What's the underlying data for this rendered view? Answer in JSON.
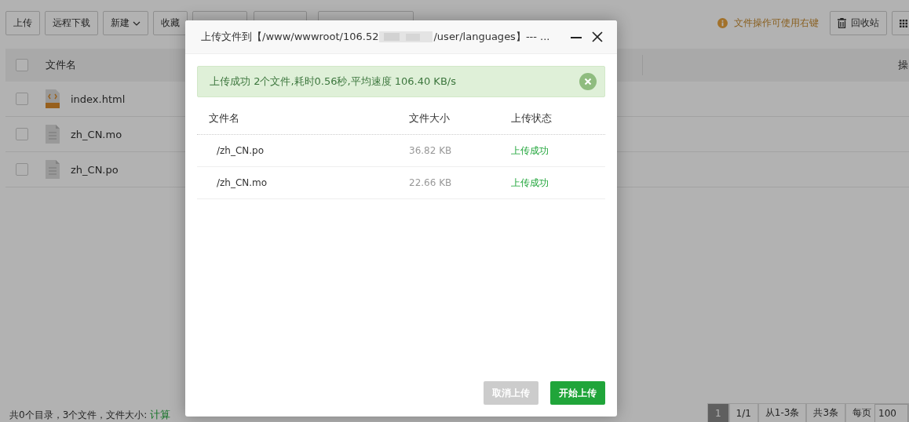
{
  "toolbar": {
    "buttons": [
      {
        "label": "上传",
        "dropdown": false
      },
      {
        "label": "远程下载",
        "dropdown": false
      },
      {
        "label": "新建",
        "dropdown": true
      },
      {
        "label": "收藏",
        "dropdown": false
      }
    ],
    "hint": "文件操作可使用右键",
    "recycle_button": "回收站"
  },
  "file_table": {
    "columns": [
      "文件名",
      "操"
    ],
    "all_checked": false,
    "rows": [
      {
        "name": "index.html",
        "kind": "html",
        "checked": false
      },
      {
        "name": "zh_CN.mo",
        "kind": "file",
        "checked": false
      },
      {
        "name": "zh_CN.po",
        "kind": "file",
        "checked": false
      }
    ]
  },
  "status_bar": {
    "summary": "共0个目录，3个文件，文件大小:",
    "link": "计算"
  },
  "pagination": {
    "pages": [
      {
        "label": "1",
        "selected": true
      }
    ],
    "total_pages": "1/1",
    "range": "从1-3条",
    "total": "共3条",
    "per_page_label": "每页",
    "per_page": "100"
  },
  "dialog": {
    "title_start": "上传文件到【/www/wwwroot/106.52",
    "title_end": "/user/languages】--- ...",
    "alert": "上传成功 2个文件,耗时0.56秒,平均速度 106.40 KB/s",
    "columns": [
      "文件名",
      "文件大小",
      "上传状态"
    ],
    "rows": [
      {
        "name": "/zh_CN.po",
        "size": "36.82 KB",
        "status": "上传成功"
      },
      {
        "name": "/zh_CN.mo",
        "size": "22.66 KB",
        "status": "上传成功"
      }
    ],
    "buttons": [
      {
        "label": "取消上传",
        "disabled": true
      },
      {
        "label": "开始上传",
        "disabled": false
      }
    ]
  }
}
